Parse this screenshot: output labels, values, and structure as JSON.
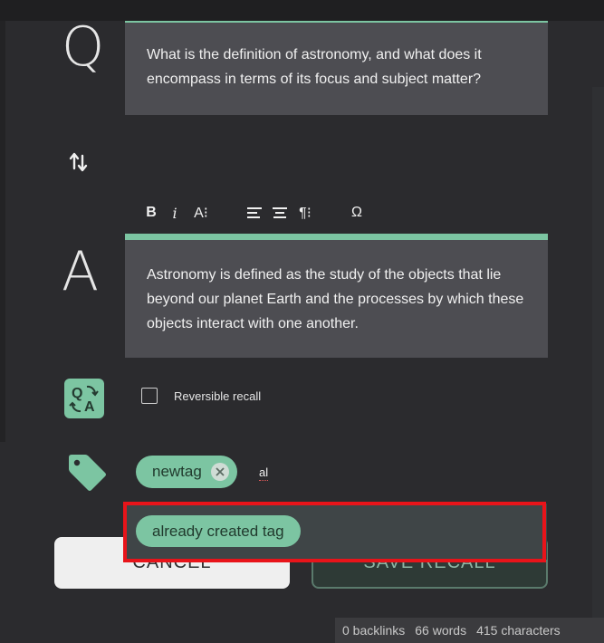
{
  "question": {
    "letter": "Q",
    "text": "What is the definition of astronomy, and what does it encompass in terms of its focus and subject matter?"
  },
  "answer": {
    "letter": "A",
    "text": "Astronomy is defined as the study of the objects that lie beyond our planet Earth and the processes by which these objects interact with one another."
  },
  "toolbar": {
    "bold": "B",
    "italic": "i",
    "font_size": "A⁝",
    "align_left": "≡",
    "align_center": "≡",
    "paragraph": "¶⁝",
    "special_char": "Ω"
  },
  "reversible": {
    "label": "Reversible recall",
    "checked": false,
    "icon": "qa-swap-icon"
  },
  "tags": {
    "icon": "tag-icon",
    "items": [
      "newtag"
    ],
    "input_value": "al",
    "suggestions": [
      "already created tag"
    ]
  },
  "buttons": {
    "cancel": "CANCEL",
    "save": "SAVE RECALL"
  },
  "status": {
    "backlinks": "0 backlinks",
    "words": "66 words",
    "characters": "415 characters"
  },
  "colors": {
    "accent": "#7cc5a2",
    "highlight": "#e8141a",
    "background": "#2b2b2e",
    "card": "#4d4d52"
  }
}
